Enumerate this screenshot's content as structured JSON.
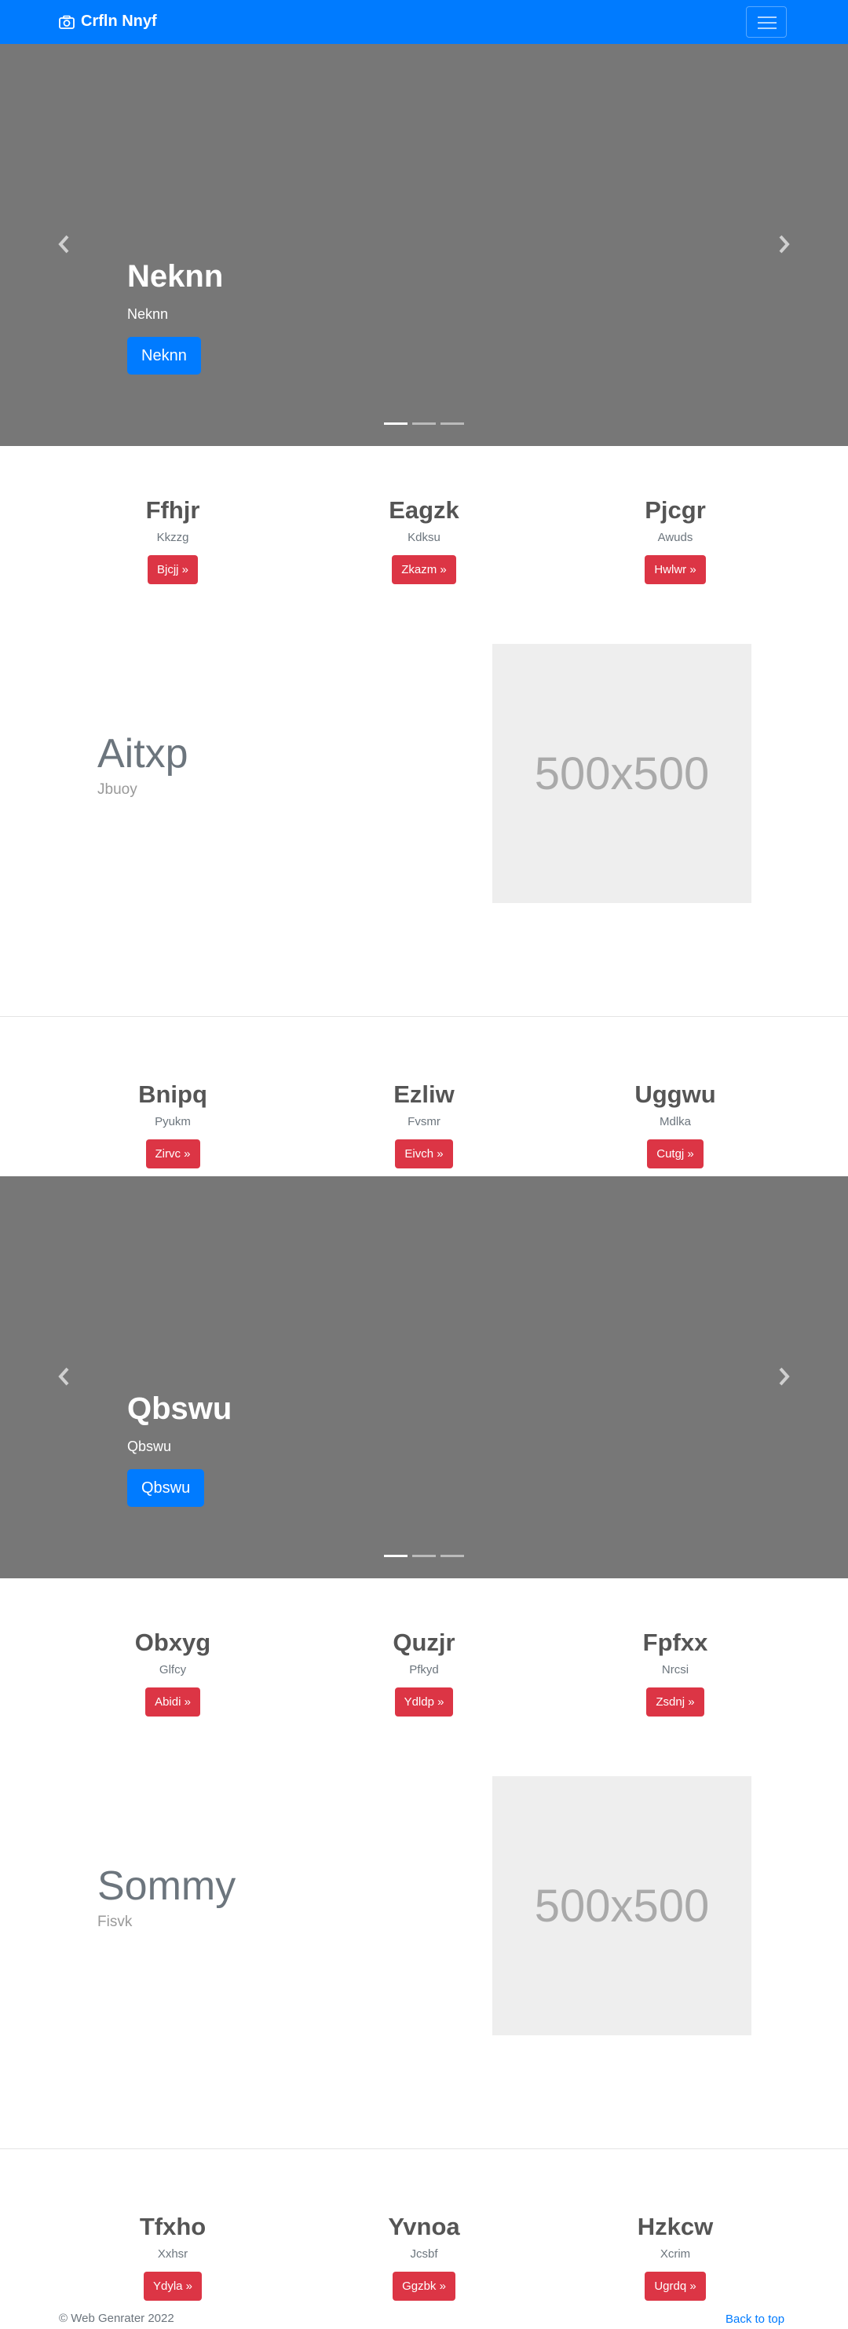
{
  "navbar": {
    "brand": "Crfln Nnyf"
  },
  "carousels": [
    {
      "title": "Neknn",
      "subtitle": "Neknn",
      "button": "Neknn"
    },
    {
      "title": "Qbswu",
      "subtitle": "Qbswu",
      "button": "Qbswu"
    }
  ],
  "row1": [
    {
      "heading": "Ffhjr",
      "text": "Kkzzg",
      "button": "Bjcjj »"
    },
    {
      "heading": "Eagzk",
      "text": "Kdksu",
      "button": "Zkazm »"
    },
    {
      "heading": "Pjcgr",
      "text": "Awuds",
      "button": "Hwlwr »"
    }
  ],
  "feature1": {
    "title": "Aitxp",
    "subtitle": "Jbuoy",
    "image_label": "500x500"
  },
  "row2": [
    {
      "heading": "Bnipq",
      "text": "Pyukm",
      "button": "Zirvc »"
    },
    {
      "heading": "Ezliw",
      "text": "Fvsmr",
      "button": "Eivch »"
    },
    {
      "heading": "Uggwu",
      "text": "Mdlka",
      "button": "Cutgj »"
    }
  ],
  "row3": [
    {
      "heading": "Obxyg",
      "text": "Glfcy",
      "button": "Abidi »"
    },
    {
      "heading": "Quzjr",
      "text": "Pfkyd",
      "button": "Ydldp »"
    },
    {
      "heading": "Fpfxx",
      "text": "Nrcsi",
      "button": "Zsdnj »"
    }
  ],
  "feature2": {
    "title": "Sommy",
    "subtitle": "Fisvk",
    "image_label": "500x500"
  },
  "row4": [
    {
      "heading": "Tfxho",
      "text": "Xxhsr",
      "button": "Ydyla »"
    },
    {
      "heading": "Yvnoa",
      "text": "Jcsbf",
      "button": "Ggzbk »"
    },
    {
      "heading": "Hzkcw",
      "text": "Xcrim",
      "button": "Ugrdq »"
    }
  ],
  "footer": {
    "copyright": "© Web Genrater 2022",
    "back_to_top": "Back to top"
  },
  "colors": {
    "primary": "#007bff",
    "danger": "#dc3545",
    "carousel_bg": "#777777",
    "placeholder_bg": "#eeeeee"
  }
}
